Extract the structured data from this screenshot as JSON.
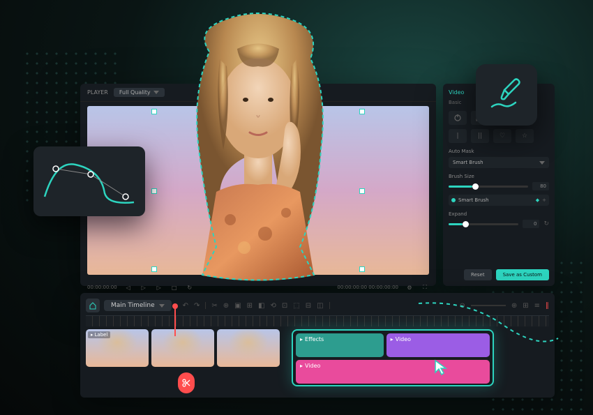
{
  "player": {
    "label": "PLAYER",
    "quality": "Full Quality",
    "timecode_left": "00:00:00:00",
    "timecode_right": "00:00:00:00  00:00:00:00"
  },
  "timeline": {
    "title": "Main Timeline",
    "clip_label": "Label"
  },
  "effects": {
    "effects_label": "Effects",
    "video_label_1": "Video",
    "video_label_2": "Video"
  },
  "side": {
    "tab_video": "Video",
    "sub_basic": "Basic",
    "auto_mask_label": "Auto Mask",
    "auto_mask_value": "Smart Brush",
    "brush_size_label": "Brush Size",
    "brush_size_value": "80",
    "smart_brush_label": "Smart Brush",
    "expand_label": "Expand",
    "expand_value": "0",
    "reset": "Reset",
    "save": "Save as Custom"
  },
  "colors": {
    "accent": "#2dd4bf",
    "danger": "#ff4d4d"
  }
}
